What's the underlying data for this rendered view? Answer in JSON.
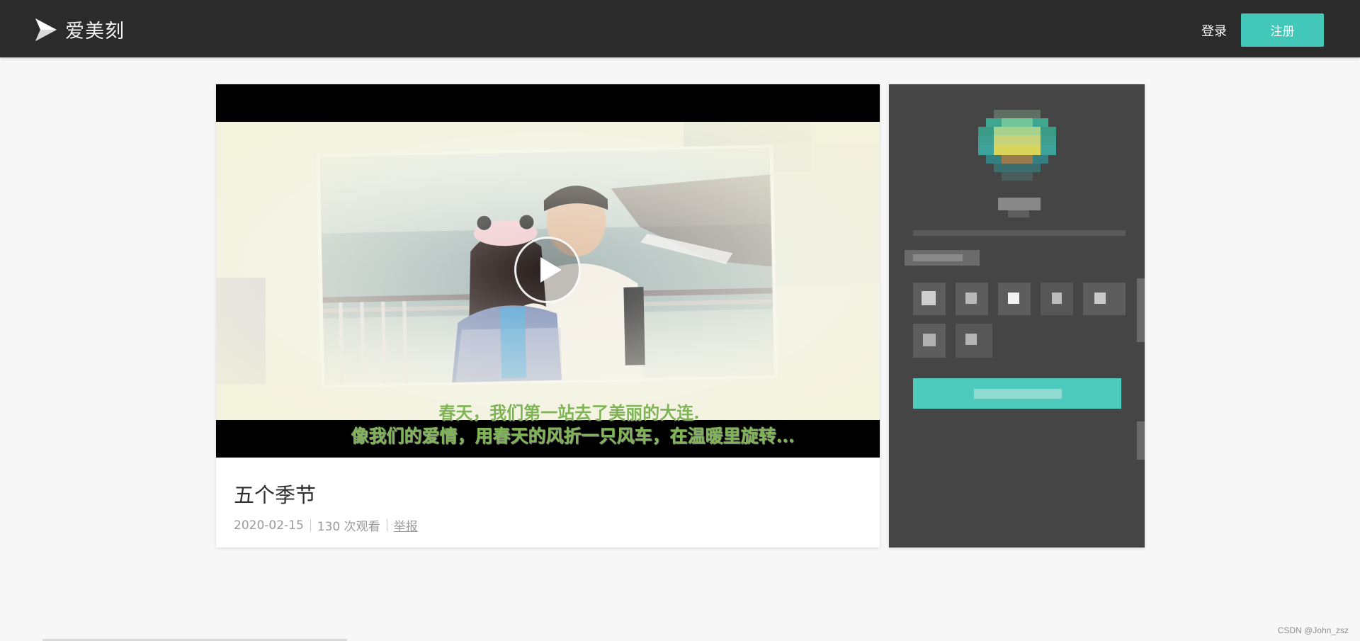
{
  "header": {
    "brand_name": "爱美刻",
    "login_label": "登录",
    "register_label": "注册"
  },
  "video": {
    "caption_line1": "春天，我们第一站去了美丽的大连.",
    "caption_line2": "像我们的爱情，用春天的风折一只风车，在温暖里旋转...",
    "title": "五个季节",
    "date": "2020-02-15",
    "views": "130 次观看",
    "report_label": "举报"
  },
  "footer": {
    "watermark": "CSDN @John_zsz"
  },
  "colors": {
    "header_bg": "#2b2b2b",
    "accent": "#42c7b8",
    "side_panel_bg": "#454545"
  }
}
